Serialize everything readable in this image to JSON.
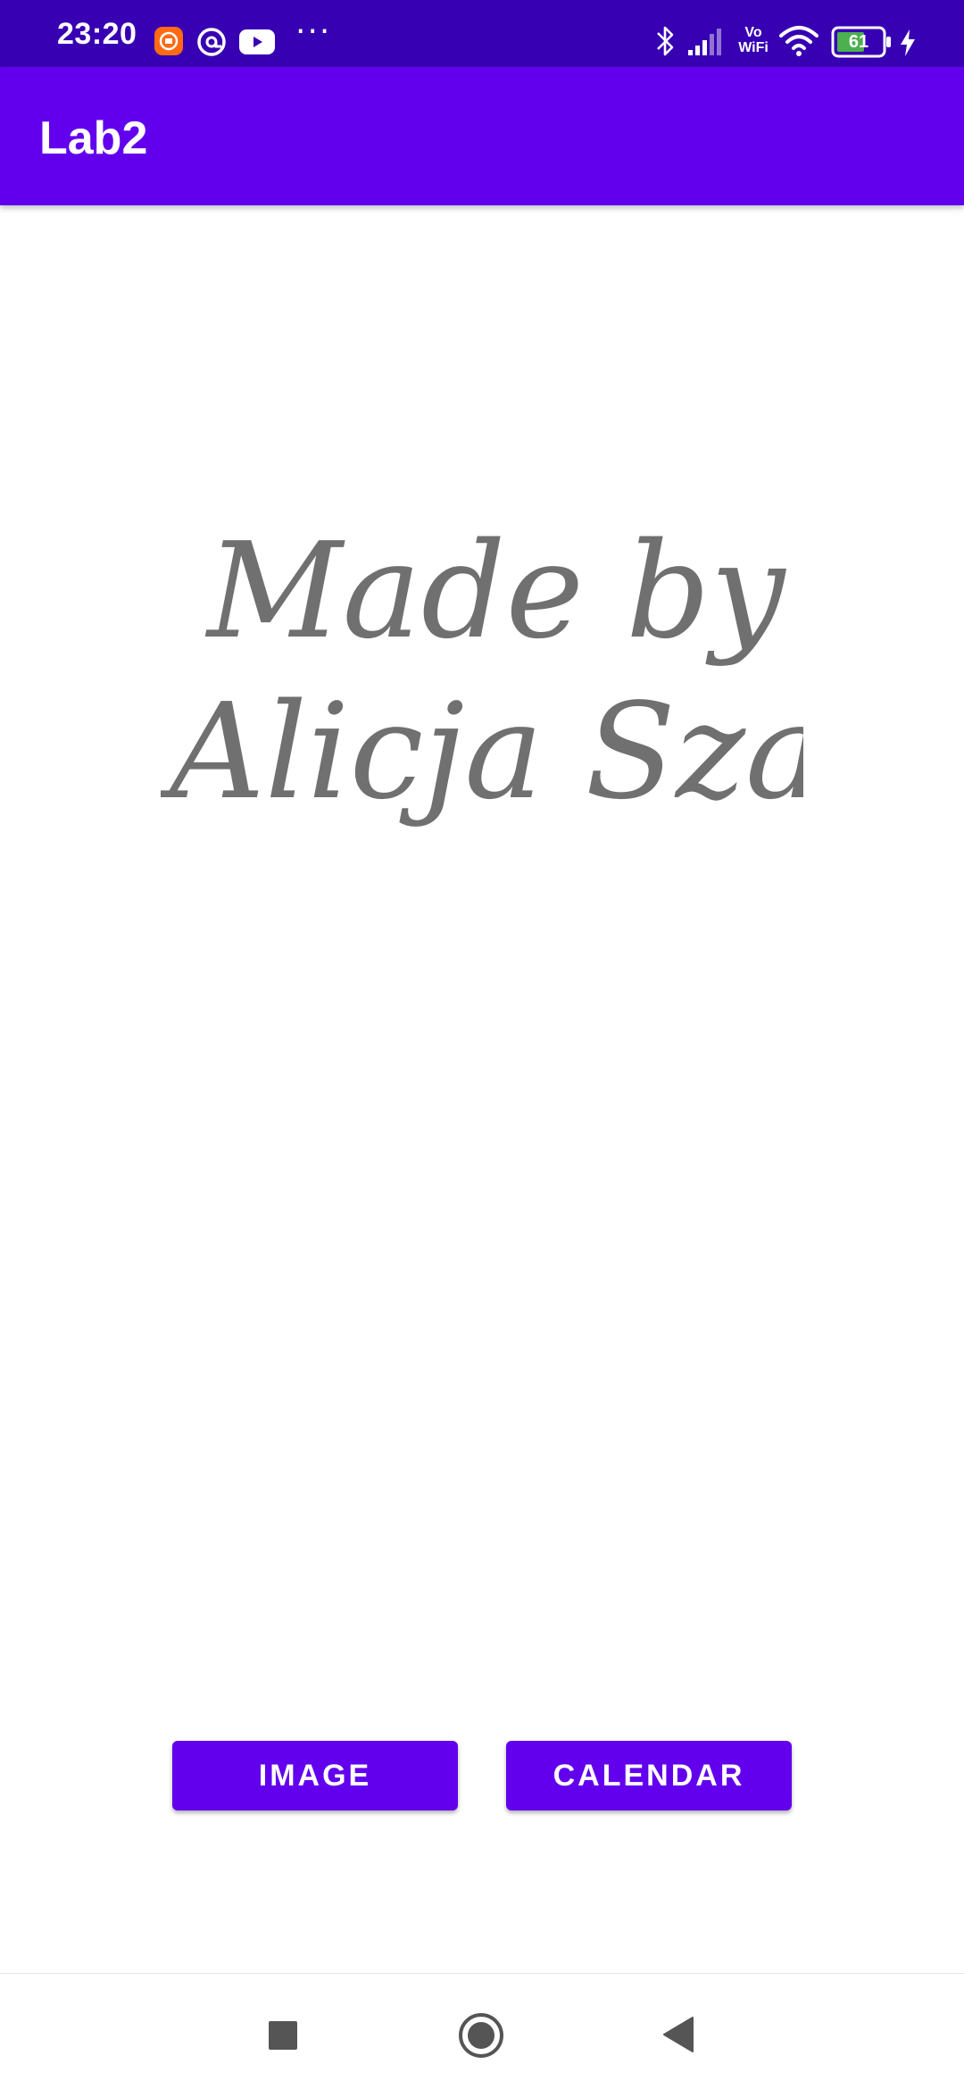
{
  "status_bar": {
    "time": "23:20",
    "more": "···",
    "vowifi_top": "Vo",
    "vowifi_bottom": "WiFi",
    "battery_level": "61",
    "icons": [
      "mi-app-icon",
      "at-icon",
      "youtube-icon",
      "more-icon",
      "bluetooth-icon",
      "signal-icon",
      "vowifi-icon",
      "wifi-icon",
      "battery-icon",
      "charging-icon"
    ]
  },
  "app_bar": {
    "title": "Lab2"
  },
  "signature": {
    "line1": "Made by",
    "line2": "Alicja Szada"
  },
  "buttons": {
    "image": "IMAGE",
    "calendar": "CALENDAR"
  },
  "nav_bar": {
    "icons": [
      "recents-icon",
      "home-icon",
      "back-icon"
    ]
  },
  "colors": {
    "status_bar": "#3700B3",
    "primary": "#6200EE",
    "signature_text": "#707070",
    "background": "#FFFFFF"
  }
}
